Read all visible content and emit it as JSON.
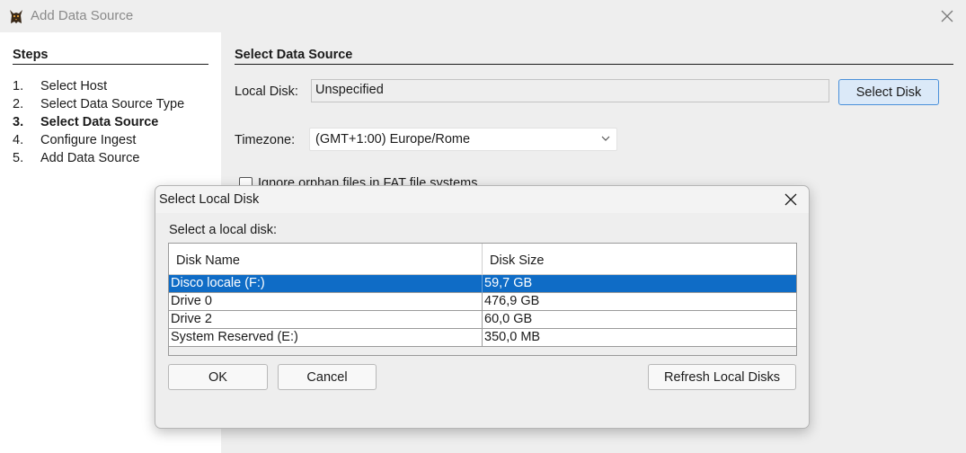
{
  "window": {
    "title": "Add Data Source",
    "icon": "autopsy-dog-icon"
  },
  "steps": {
    "heading": "Steps",
    "items": [
      {
        "num": "1.",
        "label": "Select Host",
        "active": false
      },
      {
        "num": "2.",
        "label": "Select Data Source Type",
        "active": false
      },
      {
        "num": "3.",
        "label": "Select Data Source",
        "active": true
      },
      {
        "num": "4.",
        "label": "Configure Ingest",
        "active": false
      },
      {
        "num": "5.",
        "label": "Add Data Source",
        "active": false
      }
    ]
  },
  "main": {
    "heading": "Select Data Source",
    "local_disk_label": "Local Disk:",
    "local_disk_value": "Unspecified",
    "select_disk_button": "Select Disk",
    "timezone_label": "Timezone:",
    "timezone_value": "(GMT+1:00) Europe/Rome",
    "orphan_label": "Ignore orphan files in FAT file systems"
  },
  "dialog": {
    "title": "Select Local Disk",
    "prompt": "Select a local disk:",
    "columns": [
      "Disk Name",
      "Disk Size"
    ],
    "rows": [
      {
        "name": "Disco locale (F:)",
        "size": "59,7 GB",
        "selected": true
      },
      {
        "name": "Drive 0",
        "size": "476,9 GB",
        "selected": false
      },
      {
        "name": "Drive 2",
        "size": "60,0 GB",
        "selected": false
      },
      {
        "name": "System Reserved (E:)",
        "size": "350,0 MB",
        "selected": false
      }
    ],
    "ok_button": "OK",
    "cancel_button": "Cancel",
    "refresh_button": "Refresh Local Disks"
  },
  "colors": {
    "selection": "#0f6cc6",
    "accent_border": "#4a90d9",
    "accent_fill": "#dbe9f8"
  }
}
